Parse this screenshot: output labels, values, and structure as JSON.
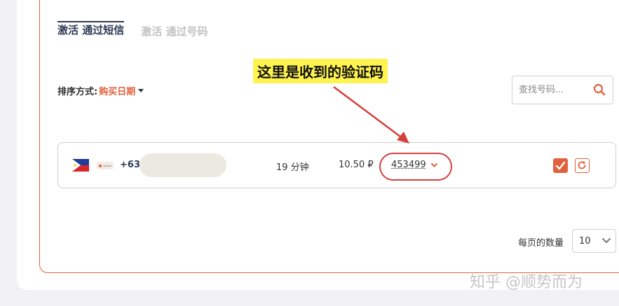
{
  "tabs": [
    {
      "label": "激活 通过短信",
      "active": true
    },
    {
      "label": "激活 通过号码",
      "active": false
    }
  ],
  "sort": {
    "label": "排序方式:",
    "value": "购买日期"
  },
  "search": {
    "placeholder": "查找号码..."
  },
  "annotation": {
    "text": "这里是收到的验证码"
  },
  "row": {
    "country_flag": "philippines-flag",
    "phone_prefix": "+63",
    "duration": "19 分钟",
    "price": "10.50 ₽",
    "code": "453499"
  },
  "pagination": {
    "label": "每页的数量",
    "value": "10"
  },
  "watermark": "知乎 @顺势而为",
  "colors": {
    "accent": "#e0623d",
    "highlight": "#fff44f",
    "annotation_red": "#d6403a",
    "tab_active": "#2d3a55"
  }
}
